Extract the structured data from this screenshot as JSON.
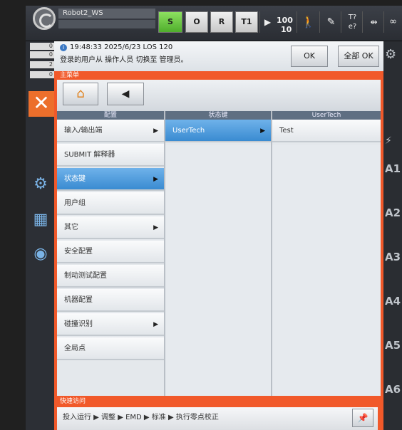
{
  "topbar": {
    "robot_name": "Robot2_WS",
    "buttons": [
      {
        "label": "S"
      },
      {
        "label": "O"
      },
      {
        "label": "R"
      },
      {
        "label": "T1"
      }
    ],
    "speed": "100",
    "speed_step": "10",
    "tool_status_top": "T?",
    "tool_status_bottom": "e?",
    "infinity_label": "∞"
  },
  "message": {
    "time": "19:48:33 2025/6/23 LOS 120",
    "text": "登录的用户从 操作人员 切换至 管理员。",
    "ok_label": "OK",
    "all_ok_label": "全部 OK"
  },
  "left_indicators": [
    "0",
    "0",
    "2",
    "0"
  ],
  "panel": {
    "title": "主菜单",
    "columns": [
      {
        "header": "配置",
        "items": [
          {
            "label": "输入/输出端",
            "arrow": "▶"
          },
          {
            "label": "SUBMIT 解释器",
            "arrow": ""
          },
          {
            "label": "状态键",
            "arrow": "▶"
          },
          {
            "label": "用户组",
            "arrow": ""
          },
          {
            "label": "其它",
            "arrow": "▶"
          },
          {
            "label": "安全配置",
            "arrow": ""
          },
          {
            "label": "制动测试配置",
            "arrow": ""
          },
          {
            "label": "机器配置",
            "arrow": ""
          },
          {
            "label": "碰撞识别",
            "arrow": "▶"
          },
          {
            "label": "全局点",
            "arrow": ""
          }
        ]
      },
      {
        "header": "状态键",
        "items": [
          {
            "label": "UserTech",
            "arrow": "▶"
          }
        ]
      },
      {
        "header": "UserTech",
        "items": [
          {
            "label": "Test",
            "arrow": ""
          }
        ]
      }
    ]
  },
  "quick": {
    "title": "快速访问",
    "path": "投入运行 ▶ 调整 ▶ EMD ▶ 标准 ▶ 执行零点校正"
  },
  "axes": [
    "A1",
    "A2",
    "A3",
    "A4",
    "A5",
    "A6"
  ]
}
